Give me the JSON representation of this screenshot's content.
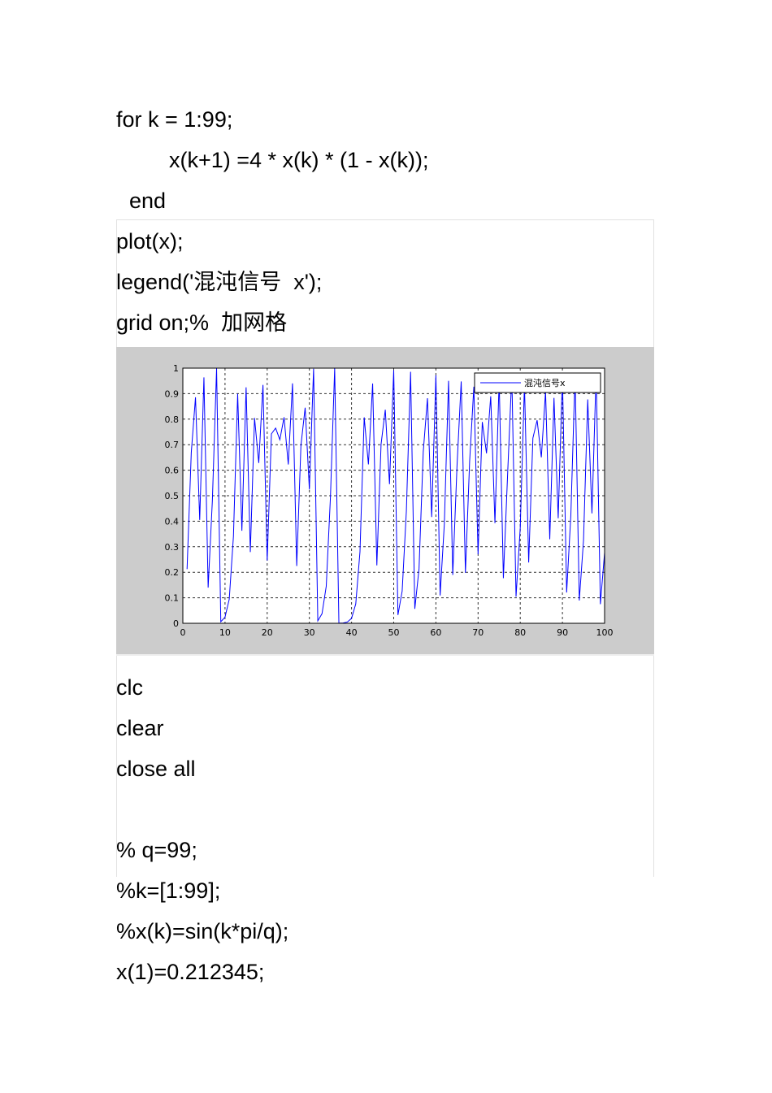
{
  "code_top": [
    "for k = 1:99;",
    "x(k+1) =4 * x(k) * (1 - x(k));",
    "end",
    "plot(x);",
    "legend('混沌信号  x');",
    "grid on;%  加网格"
  ],
  "code_bottom": [
    "clc",
    "clear",
    "close all",
    "% q=99;",
    "%k=[1:99];",
    "%x(k)=sin(k*pi/q);",
    "x(1)=0.212345;"
  ],
  "chart_data": {
    "type": "line",
    "title": "",
    "xlabel": "",
    "ylabel": "",
    "xlim": [
      0,
      100
    ],
    "ylim": [
      0,
      1
    ],
    "xticks": [
      "0",
      "10",
      "20",
      "30",
      "40",
      "50",
      "60",
      "70",
      "80",
      "90",
      "100"
    ],
    "yticks": [
      "0",
      "0.1",
      "0.2",
      "0.3",
      "0.4",
      "0.5",
      "0.6",
      "0.7",
      "0.8",
      "0.9",
      "1"
    ],
    "grid": true,
    "legend": {
      "placement": "top-right",
      "entries": [
        "混沌信号x"
      ]
    },
    "series": [
      {
        "name": "混沌信号x",
        "color": "#0000ff",
        "generator": {
          "rule": "x(k+1)=4*x(k)*(1-x(k))",
          "x1": 0.212345,
          "r": 4,
          "n": 100
        }
      }
    ]
  }
}
